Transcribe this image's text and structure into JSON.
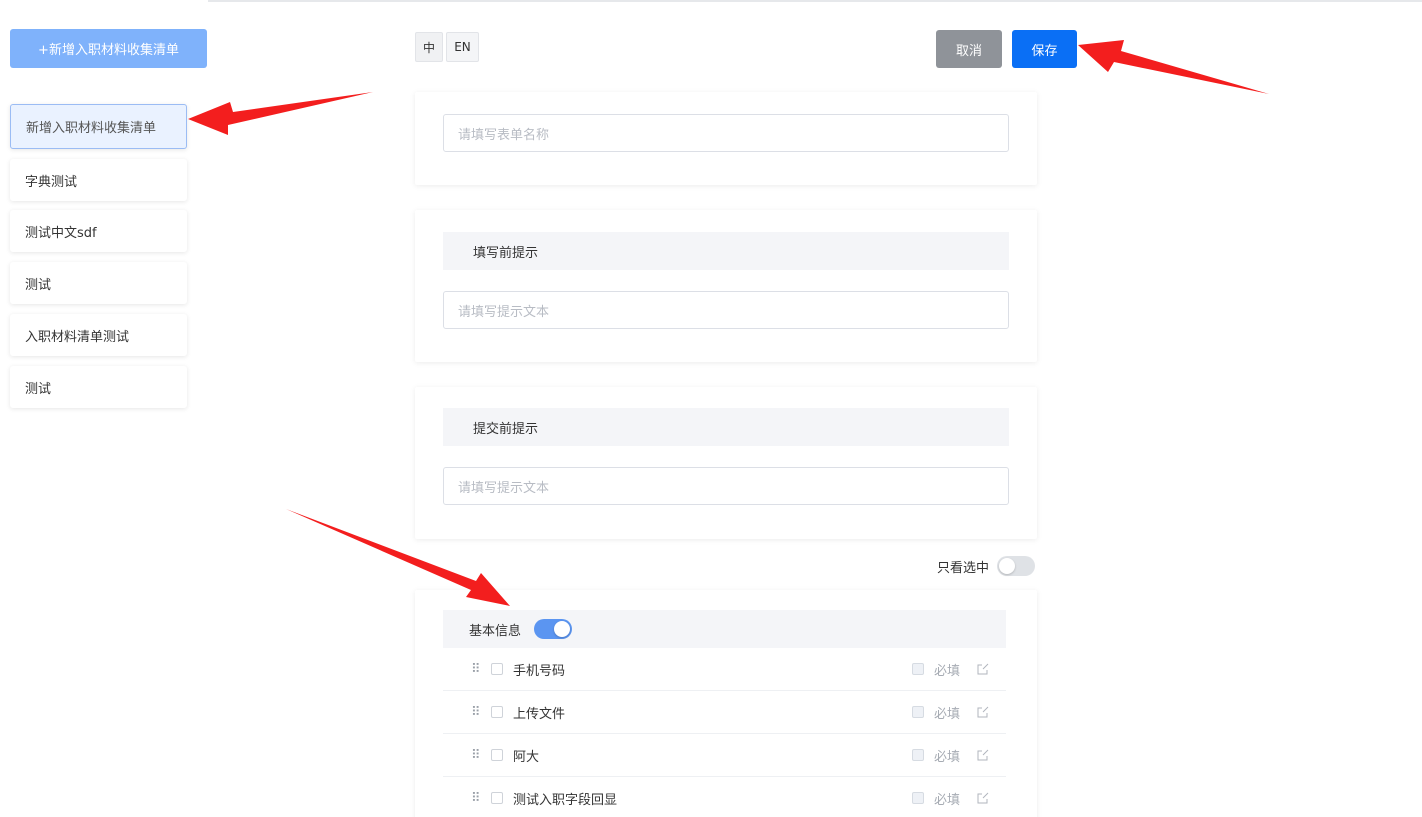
{
  "sidebar": {
    "add_label": "+新增入职材料收集清单",
    "items": [
      {
        "label": "新增入职材料收集清单"
      },
      {
        "label": "字典测试"
      },
      {
        "label": "测试中文sdf"
      },
      {
        "label": "测试"
      },
      {
        "label": "入职材料清单测试"
      },
      {
        "label": "测试"
      }
    ]
  },
  "toolbar": {
    "lang_zh": "中",
    "lang_en": "EN",
    "cancel_label": "取消",
    "save_label": "保存"
  },
  "form": {
    "name_placeholder": "请填写表单名称",
    "before_fill": {
      "title": "填写前提示",
      "placeholder": "请填写提示文本"
    },
    "before_submit": {
      "title": "提交前提示",
      "placeholder": "请填写提示文本"
    }
  },
  "filter": {
    "only_checked_label": "只看选中",
    "only_checked_on": false
  },
  "group": {
    "title": "基本信息",
    "enabled": true,
    "required_label": "必填",
    "fields": [
      {
        "label": "手机号码"
      },
      {
        "label": "上传文件"
      },
      {
        "label": "阿大"
      },
      {
        "label": "测试入职字段回显"
      }
    ]
  },
  "colors": {
    "primary": "#0a6ff5",
    "add_button": "#7fb2fb",
    "cancel": "#8f9399",
    "annotation_arrow": "#f31e1e"
  }
}
